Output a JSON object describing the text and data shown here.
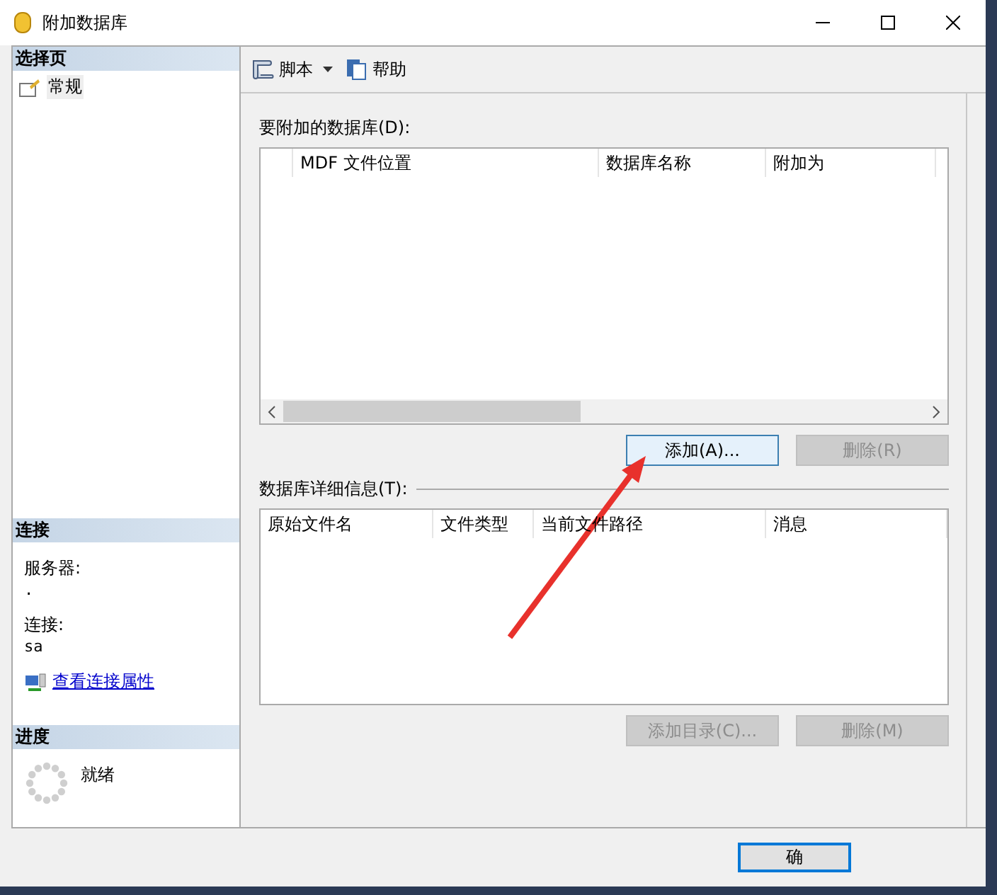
{
  "window": {
    "title": "附加数据库"
  },
  "select_page": {
    "title": "选择页",
    "items": [
      {
        "label": "常规",
        "selected": true
      }
    ]
  },
  "connection": {
    "title": "连接",
    "fields": [
      {
        "label": "服务器:",
        "value": "."
      },
      {
        "label": "连接:",
        "value": "sa"
      }
    ],
    "link": "查看连接属性"
  },
  "progress": {
    "title": "进度",
    "status": "就绪"
  },
  "toolbar": [
    {
      "kind": "script",
      "label": "脚本",
      "dropdown": true
    },
    {
      "kind": "help",
      "label": "帮助",
      "dropdown": false
    }
  ],
  "attach": {
    "label": "要附加的数据库(D):",
    "columns": [
      "",
      "MDF 文件位置",
      "数据库名称",
      "附加为"
    ],
    "buttons": [
      {
        "label": "添加(A)...",
        "disabled": false,
        "focused": true
      },
      {
        "label": "删除(R)",
        "disabled": true,
        "focused": false
      }
    ]
  },
  "details": {
    "label": "数据库详细信息(T):",
    "columns": [
      "原始文件名",
      "文件类型",
      "当前文件路径",
      "消息"
    ],
    "buttons": [
      {
        "label": "添加目录(C)...",
        "disabled": true,
        "focused": false
      },
      {
        "label": "删除(M)",
        "disabled": true,
        "focused": false
      }
    ]
  },
  "footer": {
    "buttons": [
      {
        "label": "确",
        "disabled": false,
        "focused": true
      }
    ]
  }
}
